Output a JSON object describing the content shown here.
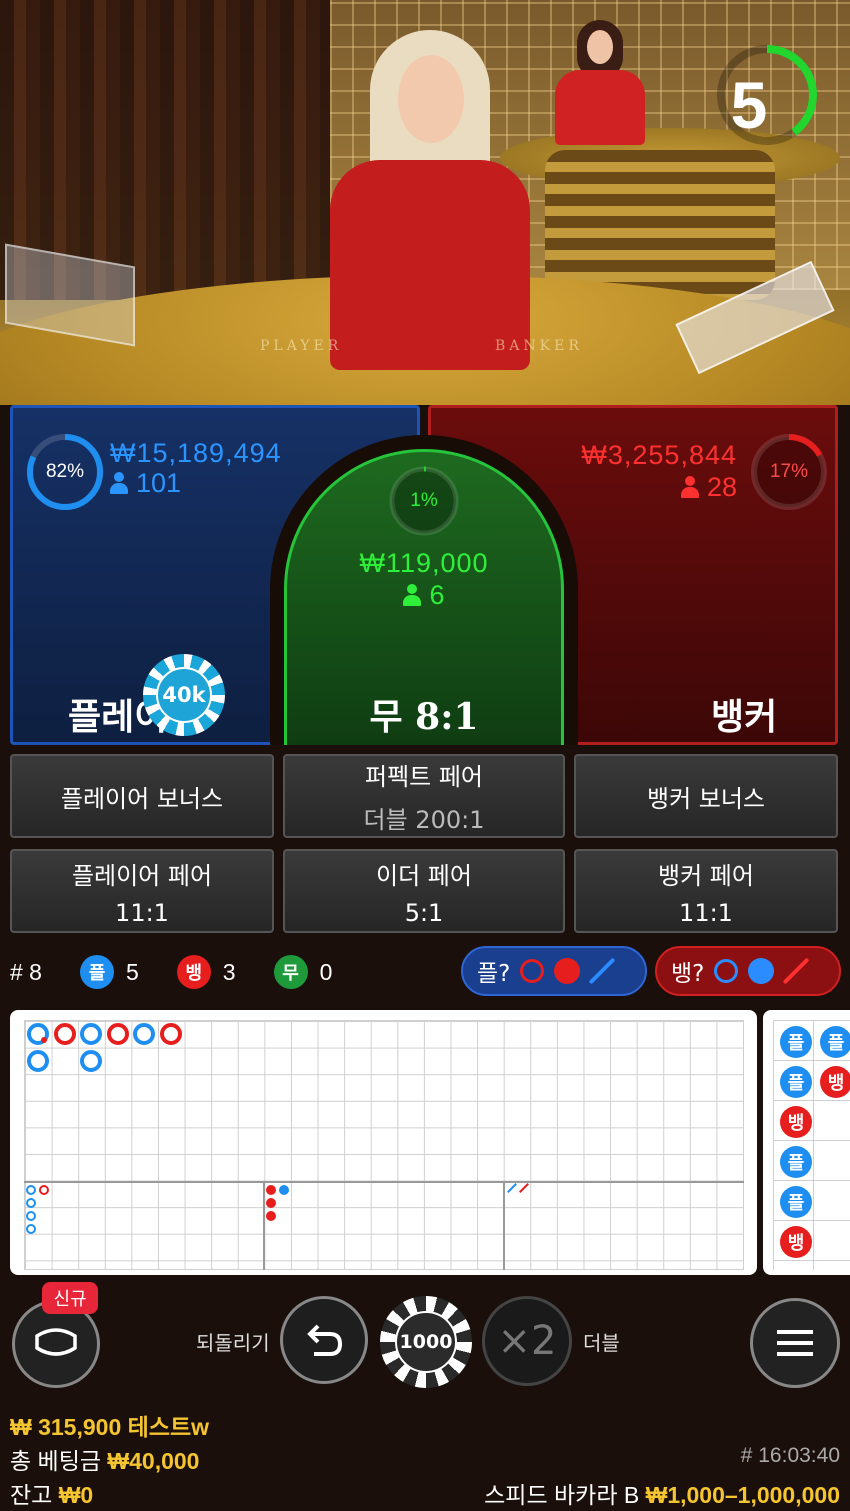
{
  "video": {
    "felt_player": "PLAYER",
    "felt_banker": "BANKER",
    "countdown": "5",
    "countdown_fraction": 0.4
  },
  "player": {
    "percent": "82%",
    "percent_value": 0.82,
    "amount": "₩15,189,494",
    "bettors": "101",
    "label": "플레이어",
    "chip": "40k",
    "color": "#1e8ff0"
  },
  "tie": {
    "percent": "1%",
    "percent_value": 0.01,
    "amount": "₩119,000",
    "bettors": "6",
    "label_prefix": "무",
    "label_payout": "8:1",
    "color": "#22d62e"
  },
  "banker": {
    "percent": "17%",
    "percent_value": 0.17,
    "amount": "₩3,255,844",
    "bettors": "28",
    "label": "뱅커",
    "color": "#e61e1e"
  },
  "side_bets": {
    "player_bonus": "플레이어 보너스",
    "perfect_pair": "퍼펙트 페어",
    "perfect_pair_sub": "더블 200:1",
    "banker_bonus": "뱅커 보너스",
    "player_pair": "플레이어 페어",
    "player_pair_sub": "11:1",
    "either_pair": "이더 페어",
    "either_pair_sub": "5:1",
    "banker_pair": "뱅커 페어",
    "banker_pair_sub": "11:1"
  },
  "stats": {
    "round": "# 8",
    "player_badge": "플",
    "player_count": "5",
    "banker_badge": "뱅",
    "banker_count": "3",
    "tie_badge": "무",
    "tie_count": "0",
    "ask_player": "플?",
    "ask_banker": "뱅?"
  },
  "side_road": {
    "cells": [
      "플",
      "플",
      "뱅",
      "플",
      "플",
      "뱅"
    ],
    "col2": [
      "플",
      "뱅"
    ]
  },
  "controls": {
    "new_badge": "신규",
    "undo_label": "되돌리기",
    "chip_value": "1000",
    "double_symbol": "×2",
    "double_label": "더블"
  },
  "footer": {
    "balance_line": "₩ 315,900 테스트w",
    "total_bet_label": "총 베팅금",
    "total_bet": "₩40,000",
    "remaining_label": "잔고",
    "remaining": "₩0",
    "time": "# 16:03:40",
    "table_name": "스피드 바카라 B",
    "limits": "₩1,000–1,000,000"
  },
  "colors": {
    "player_blue": "#1e8ff0",
    "banker_red": "#e61e1e",
    "tie_green": "#22d62e",
    "gold": "#f5c531"
  }
}
